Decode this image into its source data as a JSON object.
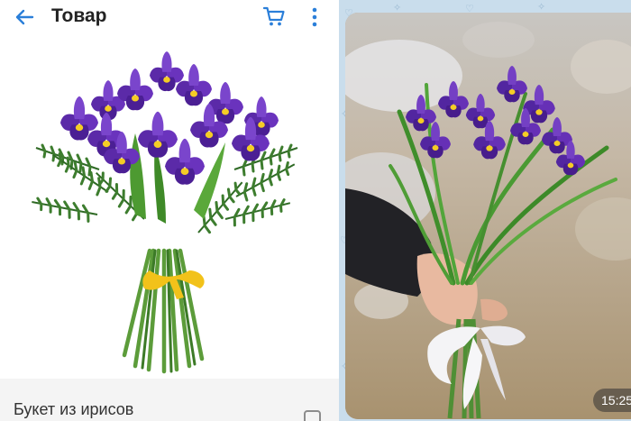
{
  "shop": {
    "title": "Товар",
    "product_name": "Букет из ирисов",
    "accent_color": "#2b7fd9",
    "icons": {
      "back": "arrow-left-icon",
      "cart": "cart-icon",
      "more": "more-vertical-icon",
      "favorite": "checkbox-icon"
    }
  },
  "chat": {
    "message_time": "15:25"
  }
}
